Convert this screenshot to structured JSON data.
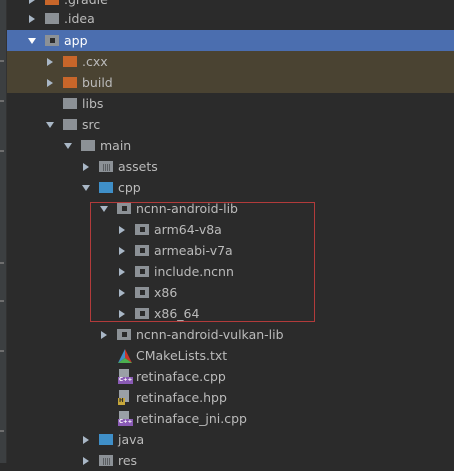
{
  "tree": {
    "gradle_label": ".gradle",
    "idea_label": ".idea",
    "app_label": "app",
    "cxx_label": ".cxx",
    "build_label": "build",
    "libs_label": "libs",
    "src_label": "src",
    "main_label": "main",
    "assets_label": "assets",
    "cpp_label": "cpp",
    "ncnn_android_lib_label": "ncnn-android-lib",
    "arm64_label": "arm64-v8a",
    "armeabi_label": "armeabi-v7a",
    "include_label": "include.ncnn",
    "x86_label": "x86",
    "x86_64_label": "x86_64",
    "vulkan_lib_label": "ncnn-android-vulkan-lib",
    "cmakelists_label": "CMakeLists.txt",
    "retinaface_cpp_label": "retinaface.cpp",
    "retinaface_hpp_label": "retinaface.hpp",
    "retinaface_jni_label": "retinaface_jni.cpp",
    "java_label": "java",
    "res_label": "res"
  },
  "icons": {
    "cpp_tag": "C++",
    "h_tag": "H"
  },
  "colors": {
    "background": "#2b2b2b",
    "selection": "#4b6eaf",
    "excluded_folder": "#c8662a",
    "source_folder": "#3f8fc8",
    "highlight_box": "#b23b3b"
  }
}
